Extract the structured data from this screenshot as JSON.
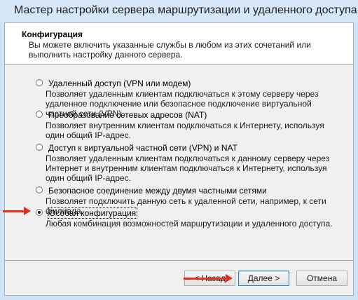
{
  "window": {
    "title": "Мастер настройки сервера маршрутизации и удаленного доступа"
  },
  "header": {
    "title": "Конфигурация",
    "description": "Вы можете включить указанные службы в любом из этих сочетаний или выполнить настройку данного сервера."
  },
  "options": [
    {
      "label": "Удаленный доступ (VPN или модем)",
      "description": "Позволяет удаленным клиентам подключаться к этому серверу через удаленное подключение или безопасное подключение виртуальной частной сети (VPN)",
      "selected": false
    },
    {
      "label": "Преобразование сетевых адресов (NAT)",
      "description": "Позволяет внутренним клиентам подключаться к Интернету, используя один общий IP-адрес.",
      "selected": false
    },
    {
      "label": "Доступ к виртуальной частной сети (VPN) и NAT",
      "description": "Позволяет удаленным клиентам подключаться к данному серверу через Интернет и внутренним клиентам подключаться к Интернету, используя один общий IP-адрес.",
      "selected": false
    },
    {
      "label": "Безопасное соединение между двумя частными сетями",
      "description": "Позволяет подключить данную сеть к удаленной сети, например, к сети филиала.",
      "selected": false
    },
    {
      "label": "Особая конфигурация",
      "description": "Любая комбинация возможностей маршрутизации и удаленного доступа.",
      "selected": true
    }
  ],
  "buttons": {
    "back": "< Назад",
    "next": "Далее >",
    "cancel": "Отмена"
  },
  "colors": {
    "annotation_arrow": "#e0301e"
  }
}
